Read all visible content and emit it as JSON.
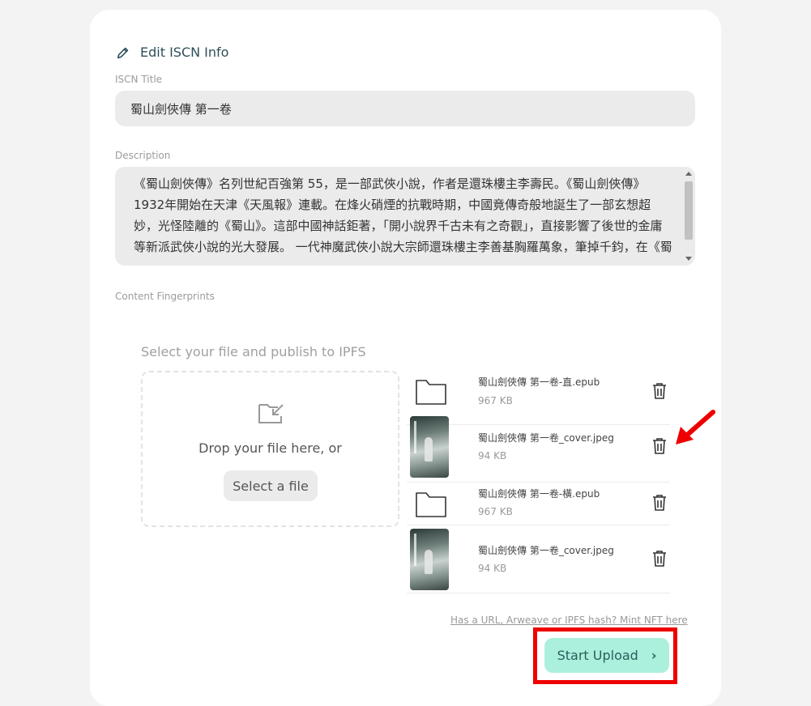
{
  "header": {
    "title": "Edit ISCN Info"
  },
  "form": {
    "title_label": "ISCN Title",
    "title_value": "蜀山劍俠傳 第一卷",
    "description_label": "Description",
    "description_value": "《蜀山劍俠傳》名列世紀百強第 55，是一部武俠小說，作者是還珠樓主李壽民。《蜀山劍俠傳》1932年開始在天津《天風報》連載。在烽火硝煙的抗戰時期，中國竟傳奇般地誕生了一部玄想超妙，光怪陸離的《蜀山》。這部中國神話鉅著，「開小說界千古未有之奇觀」，直接影響了後世的金庸等新派武俠小說的光大發展。 一代神魔武俠小說大宗師還珠樓主李善基胸羅萬象，筆掉千鈞，在《蜀山》中創造了思想天開的仙道世界。",
    "fingerprints_label": "Content Fingerprints"
  },
  "upload": {
    "heading": "Select your file and publish to IPFS",
    "drop_text": "Drop your file here, or",
    "select_button": "Select a file",
    "files": [
      {
        "name": "蜀山劍俠傳 第一卷-直.epub",
        "size": "967 KB",
        "type": "folder"
      },
      {
        "name": "蜀山劍俠傳 第一卷_cover.jpeg",
        "size": "94 KB",
        "type": "image"
      },
      {
        "name": "蜀山劍俠傳 第一卷-橫.epub",
        "size": "967 KB",
        "type": "folder"
      },
      {
        "name": "蜀山劍俠傳 第一卷_cover.jpeg",
        "size": "94 KB",
        "type": "image"
      }
    ],
    "mint_link": "Has a URL, Arweave or IPFS hash? Mint NFT here",
    "start_button": "Start Upload",
    "start_chevron": "›"
  },
  "colors": {
    "accent": "#aaf0dd",
    "highlight": "#ee0000",
    "title": "#2f4f5a"
  },
  "icons": [
    "pencil-icon",
    "folder-icon",
    "trash-icon",
    "drop-file-icon",
    "chevron-right-icon",
    "red-arrow-annotation"
  ]
}
